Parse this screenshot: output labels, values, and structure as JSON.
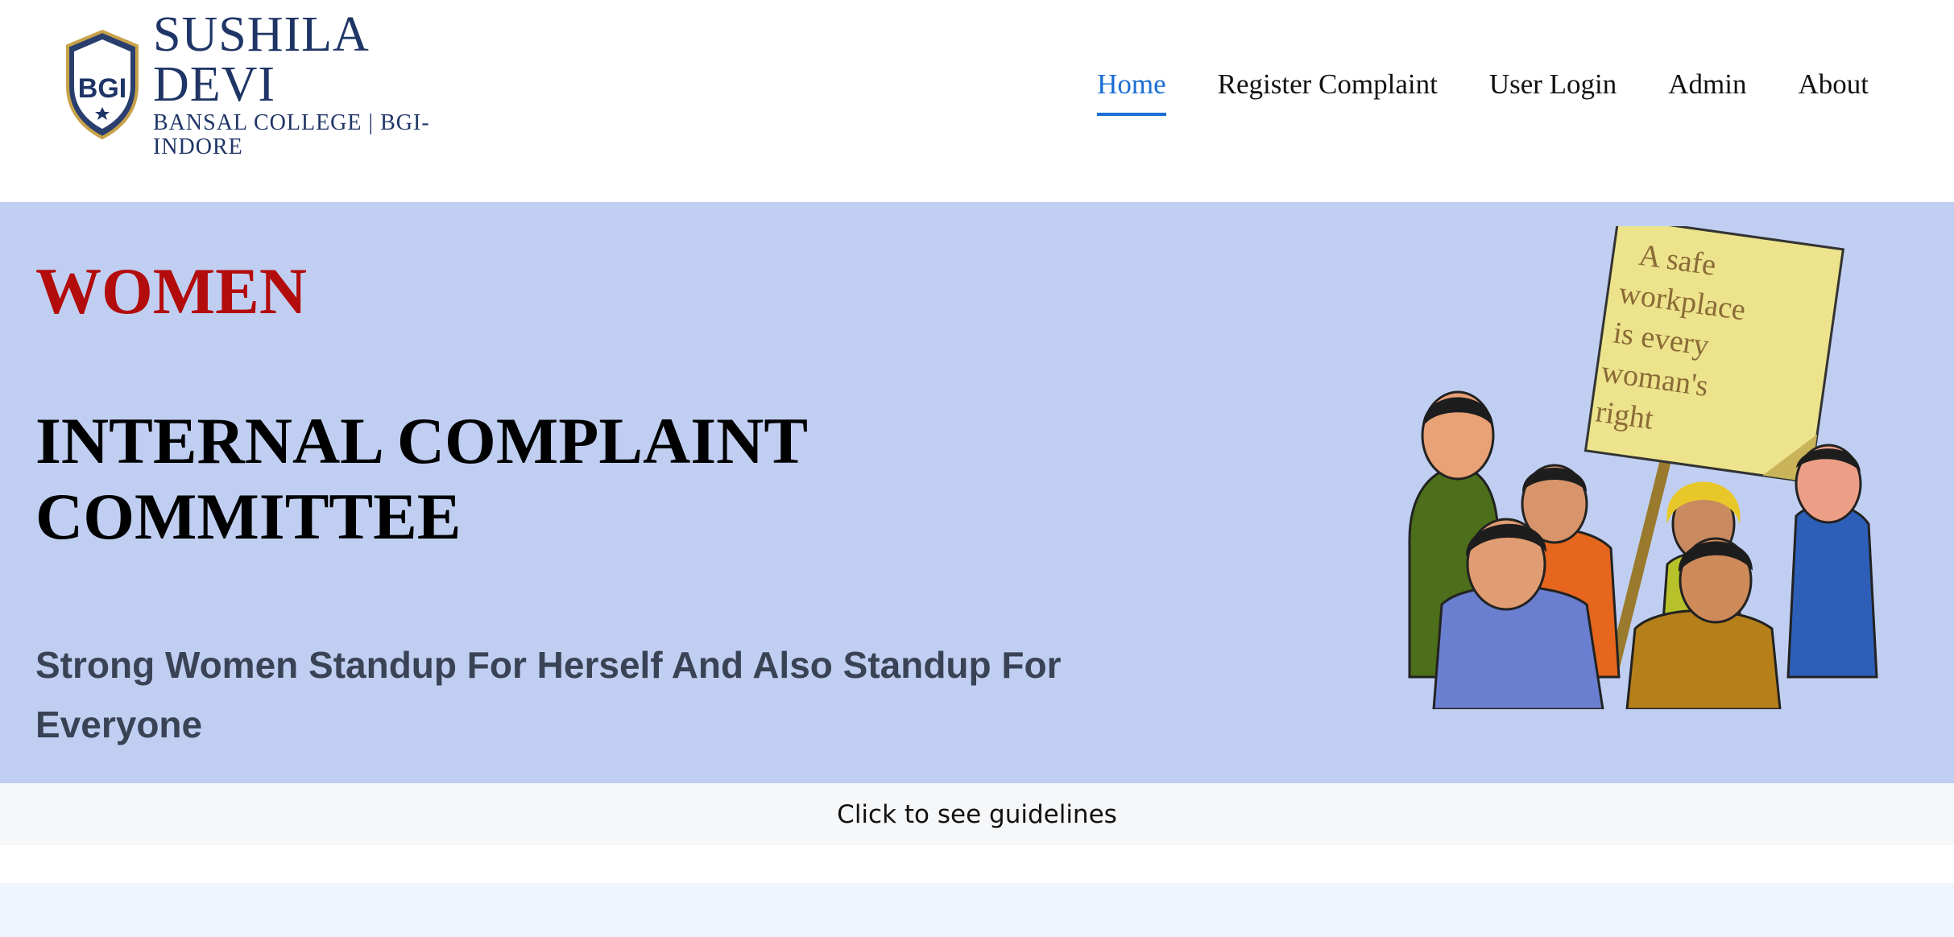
{
  "logo": {
    "initials": "BGI",
    "title": "SUSHILA DEVI",
    "subtitle": "BANSAL COLLEGE | BGI-INDORE"
  },
  "nav": {
    "items": [
      {
        "label": "Home",
        "active": true
      },
      {
        "label": "Register Complaint",
        "active": false
      },
      {
        "label": "User Login",
        "active": false
      },
      {
        "label": "Admin",
        "active": false
      },
      {
        "label": "About",
        "active": false
      }
    ]
  },
  "hero": {
    "women": "WOMEN",
    "title": "INTERNAL COMPLAINT COMMITTEE",
    "tagline": "Strong Women Standup For Herself And Also Standup For Everyone",
    "placard_lines": [
      "A safe",
      "workplace",
      "is every",
      "woman's",
      "right"
    ]
  },
  "guidelines": {
    "label": "Click to see guidelines"
  },
  "colors": {
    "accent": "#1a6fd4",
    "hero_bg": "#c0cff1",
    "women_red": "#b30c0c",
    "brand_navy": "#1f3566",
    "tagline": "#394355"
  },
  "icons": {
    "logo": "shield-logo-icon",
    "illustration": "women-group-placard-illustration"
  }
}
